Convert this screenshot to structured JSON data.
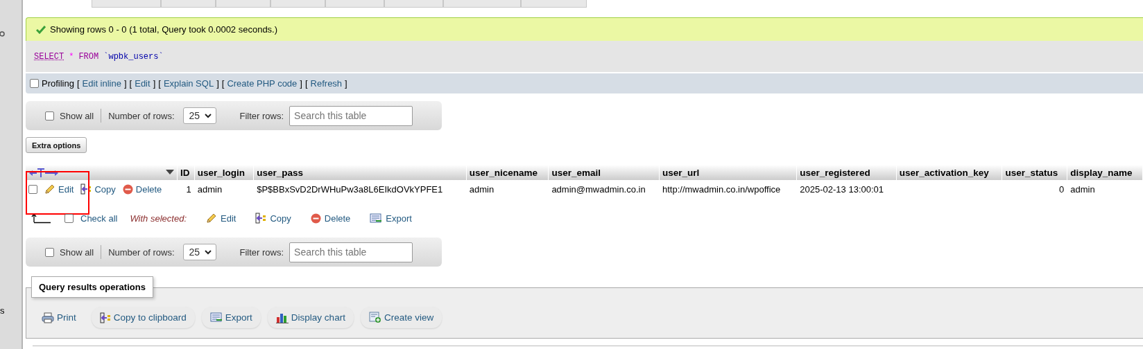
{
  "sidebar": {
    "fragment": "s"
  },
  "message": {
    "kind": "success",
    "text": "Showing rows 0 - 0 (1 total, Query took 0.0002 seconds.)"
  },
  "sql": {
    "tokens": [
      {
        "kind": "keyword",
        "text": "SELECT"
      },
      {
        "kind": "operator",
        "text": "*"
      },
      {
        "kind": "keyword",
        "text": "FROM"
      },
      {
        "kind": "identifier",
        "text": "`wpbk_users`"
      }
    ]
  },
  "profiling": {
    "label": "Profiling",
    "checked": false,
    "bracket_open": "[",
    "bracket_close": "]",
    "links": [
      "Edit inline",
      "Edit",
      "Explain SQL",
      "Create PHP code",
      "Refresh"
    ]
  },
  "nav_top": {
    "show_all": "Show all",
    "show_all_checked": false,
    "rows_label": "Number of rows:",
    "rows_value": "25",
    "filter_label": "Filter rows:",
    "filter_placeholder": "Search this table"
  },
  "extra_options": "Extra options",
  "table": {
    "columns": [
      {
        "label": "ID",
        "numeric": true
      },
      {
        "label": "user_login",
        "numeric": false
      },
      {
        "label": "user_pass",
        "numeric": false
      },
      {
        "label": "user_nicename",
        "numeric": false
      },
      {
        "label": "user_email",
        "numeric": false
      },
      {
        "label": "user_url",
        "numeric": false
      },
      {
        "label": "user_registered",
        "numeric": false
      },
      {
        "label": "user_activation_key"
      },
      {
        "label": "user_status",
        "numeric": true
      },
      {
        "label": "display_name",
        "numeric": false
      }
    ],
    "rows": [
      {
        "checked": false,
        "actions": [
          {
            "kind": "edit",
            "label": "Edit"
          },
          {
            "kind": "copy",
            "label": "Copy"
          },
          {
            "kind": "delete",
            "label": "Delete"
          }
        ],
        "cells": [
          "1",
          "admin",
          "$P$BBxSvD2DrWHuPw3a8L6EIkdOVkYPFE1",
          "admin",
          "admin@mwadmin.co.in",
          "http://mwadmin.co.in/wpoffice",
          "2025-02-13 13:00:01",
          null,
          "0",
          "admin"
        ]
      }
    ]
  },
  "bulk": {
    "check_all": "Check all",
    "checked": false,
    "with_selected": "With selected:",
    "actions": [
      {
        "kind": "edit",
        "label": "Edit"
      },
      {
        "kind": "copy",
        "label": "Copy"
      },
      {
        "kind": "delete",
        "label": "Delete"
      },
      {
        "kind": "export",
        "label": "Export"
      }
    ]
  },
  "nav_bottom": {
    "show_all": "Show all",
    "show_all_checked": false,
    "rows_label": "Number of rows:",
    "rows_value": "25",
    "filter_label": "Filter rows:",
    "filter_placeholder": "Search this table"
  },
  "operations": {
    "legend": "Query results operations",
    "actions": [
      {
        "kind": "print",
        "label": "Print"
      },
      {
        "kind": "copy",
        "label": "Copy to clipboard"
      },
      {
        "kind": "export",
        "label": "Export"
      },
      {
        "kind": "chart",
        "label": "Display chart"
      },
      {
        "kind": "view",
        "label": "Create view"
      }
    ]
  },
  "annotations": [
    {
      "kind": "rect",
      "color": "#ff0000"
    }
  ]
}
